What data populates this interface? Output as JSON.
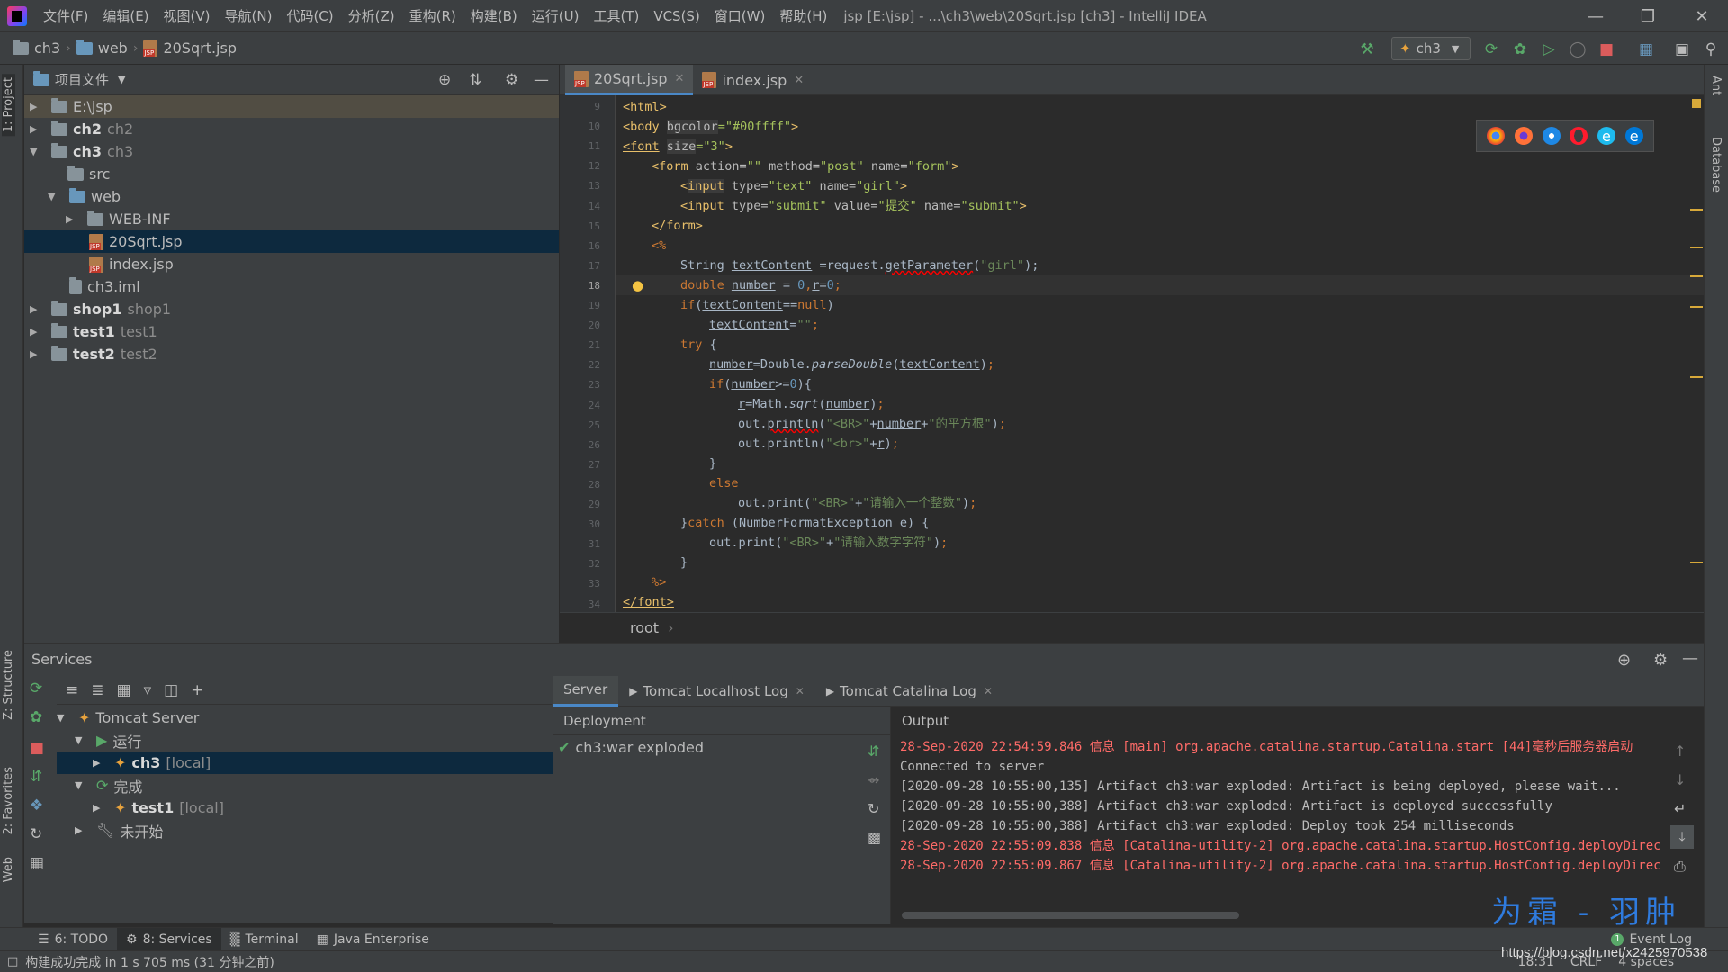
{
  "app": {
    "menu": [
      "文件(F)",
      "编辑(E)",
      "视图(V)",
      "导航(N)",
      "代码(C)",
      "分析(Z)",
      "重构(R)",
      "构建(B)",
      "运行(U)",
      "工具(T)",
      "VCS(S)",
      "窗口(W)",
      "帮助(H)"
    ],
    "title": "jsp [E:\\jsp] - ...\\ch3\\web\\20Sqrt.jsp [ch3] - IntelliJ IDEA"
  },
  "navbar": {
    "crumbs": [
      "ch3",
      "web",
      "20Sqrt.jsp"
    ],
    "run_config": "ch3"
  },
  "stripes": {
    "left": [
      "1: Project",
      "Z: Structure",
      "2: Favorites",
      "Web"
    ],
    "right": [
      "Ant",
      "Database"
    ]
  },
  "project": {
    "header": "项目文件",
    "items": [
      {
        "name": "E:\\jsp",
        "hint": ""
      },
      {
        "name": "ch2",
        "hint": "ch2"
      },
      {
        "name": "ch3",
        "hint": "ch3"
      },
      {
        "name": "src",
        "hint": ""
      },
      {
        "name": "web",
        "hint": ""
      },
      {
        "name": "WEB-INF",
        "hint": ""
      },
      {
        "name": "20Sqrt.jsp",
        "hint": ""
      },
      {
        "name": "index.jsp",
        "hint": ""
      },
      {
        "name": "ch3.iml",
        "hint": ""
      },
      {
        "name": "shop1",
        "hint": "shop1"
      },
      {
        "name": "test1",
        "hint": "test1"
      },
      {
        "name": "test2",
        "hint": "test2"
      }
    ]
  },
  "editor": {
    "tabs": [
      "20Sqrt.jsp",
      "index.jsp"
    ],
    "line_numbers": [
      "9",
      "10",
      "11",
      "12",
      "13",
      "14",
      "15",
      "16",
      "17",
      "18",
      "19",
      "20",
      "21",
      "22",
      "23",
      "24",
      "25",
      "26",
      "27",
      "28",
      "29",
      "30",
      "31",
      "32",
      "33",
      "34"
    ],
    "breadcrumb": "root"
  },
  "services": {
    "title": "Services",
    "tree": [
      {
        "label": "Tomcat Server",
        "hint": ""
      },
      {
        "label": "运行",
        "hint": ""
      },
      {
        "label": "ch3",
        "hint": "[local]"
      },
      {
        "label": "完成",
        "hint": ""
      },
      {
        "label": "test1",
        "hint": "[local]"
      },
      {
        "label": "未开始",
        "hint": ""
      }
    ],
    "tabs": [
      "Server",
      "Tomcat Localhost Log",
      "Tomcat Catalina Log"
    ],
    "deployment_header": "Deployment",
    "deployment_item": "ch3:war exploded",
    "output_header": "Output",
    "output": [
      {
        "text": "28-Sep-2020 22:54:59.846 信息 [main] org.apache.catalina.startup.Catalina.start [44]毫秒后服务器启动",
        "color": "red"
      },
      {
        "text": "Connected to server",
        "color": "grey"
      },
      {
        "text": "[2020-09-28 10:55:00,135] Artifact ch3:war exploded: Artifact is being deployed, please wait...",
        "color": "grey"
      },
      {
        "text": "[2020-09-28 10:55:00,388] Artifact ch3:war exploded: Artifact is deployed successfully",
        "color": "grey"
      },
      {
        "text": "[2020-09-28 10:55:00,388] Artifact ch3:war exploded: Deploy took 254 milliseconds",
        "color": "grey"
      },
      {
        "text": "28-Sep-2020 22:55:09.838 信息 [Catalina-utility-2] org.apache.catalina.startup.HostConfig.deployDirectory 把",
        "color": "red"
      },
      {
        "text": "28-Sep-2020 22:55:09.867 信息 [Catalina-utility-2] org.apache.catalina.startup.HostConfig.deployDirectory",
        "color": "red"
      }
    ]
  },
  "bottom_tabs": [
    "6: TODO",
    "8: Services",
    "Terminal",
    "Java Enterprise"
  ],
  "event_log": "Event Log",
  "status": {
    "message": "构建成功完成 in 1 s 705 ms (31 分钟之前)",
    "position": "18:31",
    "line_sep": "CRLF",
    "indent": "4 spaces"
  },
  "watermark": {
    "text": "为霜 - 羽肿",
    "url": "https://blog.csdn.net/x2425970538"
  },
  "colors": {
    "accent": "#4a88c7",
    "bg": "#2b2b2b",
    "panel": "#3c3f41",
    "selection": "#0d293e",
    "error": "#ff6b68"
  }
}
